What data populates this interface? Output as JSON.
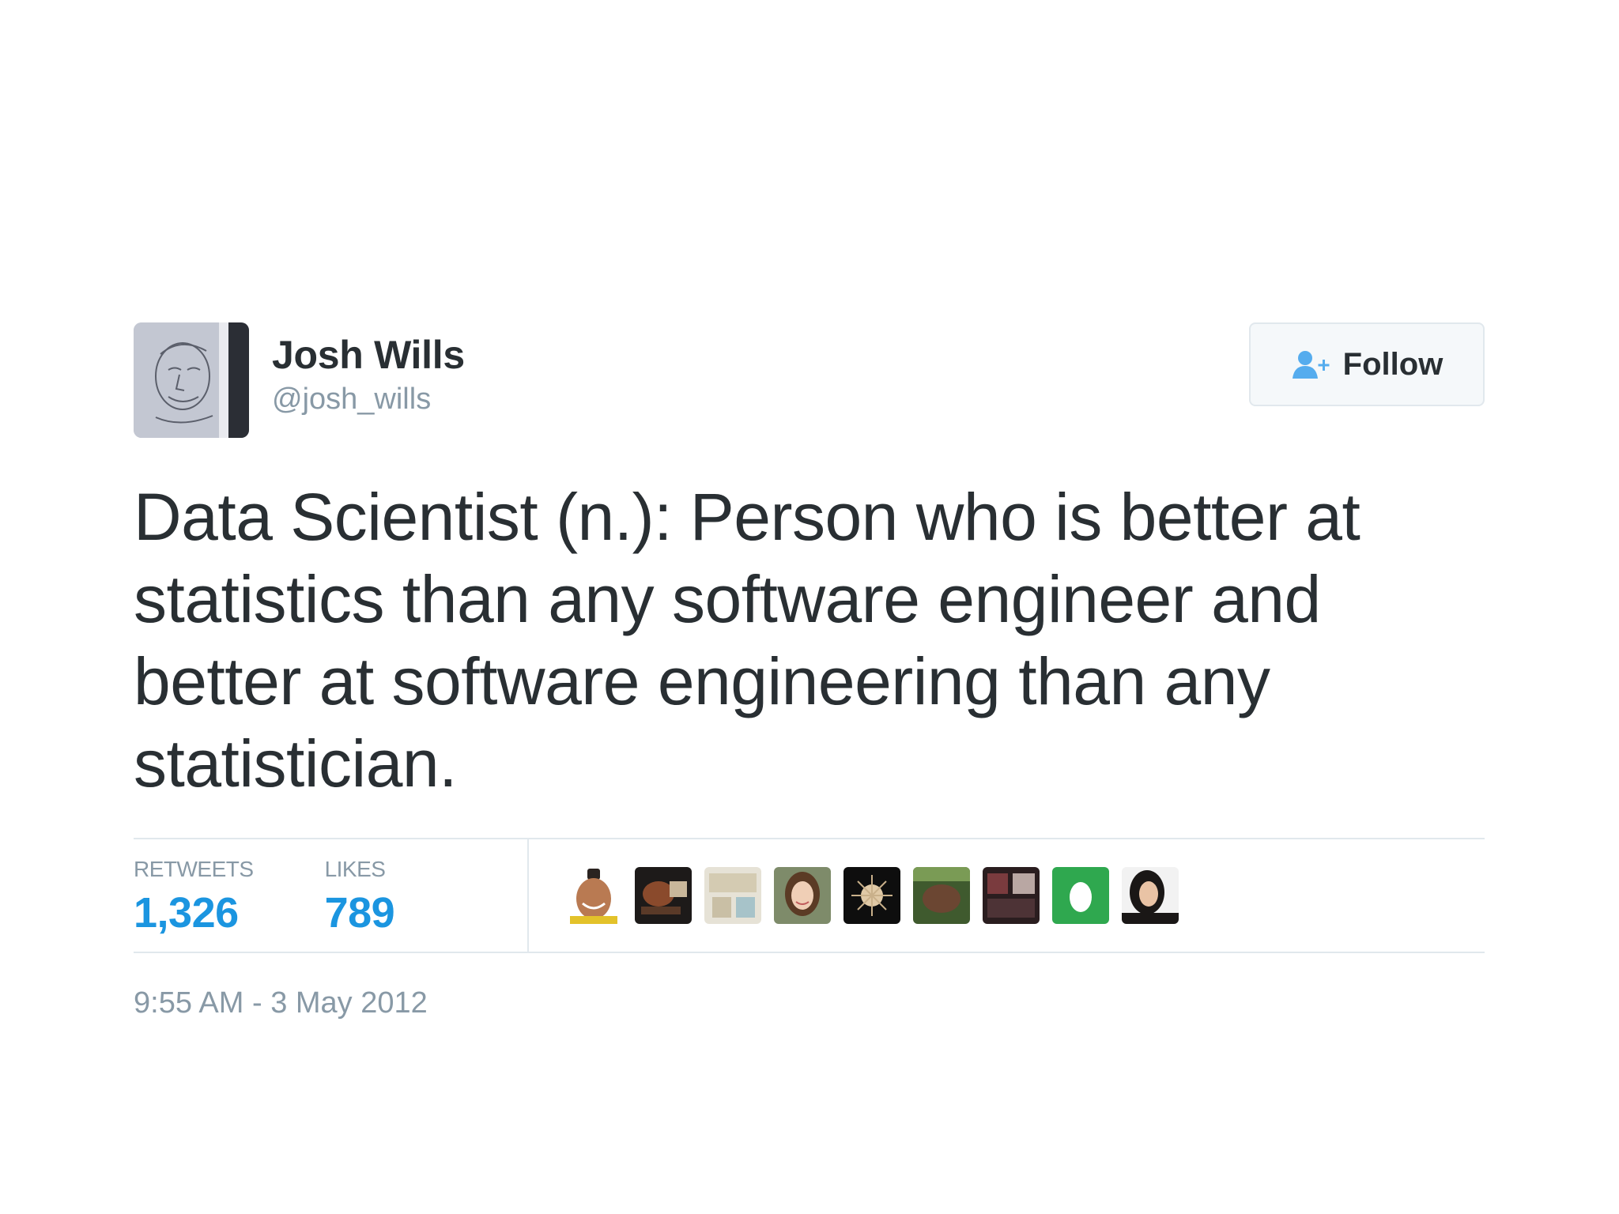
{
  "tweet": {
    "author": {
      "display_name": "Josh Wills",
      "handle": "@josh_wills",
      "avatar_icon": "caricature-sketch-avatar"
    },
    "follow_button": {
      "label": "Follow",
      "icon": "add-user-icon"
    },
    "text": "Data Scientist (n.): Person who is better at statistics than any software engineer and better at software engineering than any statistician.",
    "stats": {
      "retweets_label": "RETWEETS",
      "retweets_value": "1,326",
      "likes_label": "LIKES",
      "likes_value": "789"
    },
    "timestamp": "9:55 AM - 3 May 2012"
  },
  "colors": {
    "text": "#292f33",
    "muted": "#8899a6",
    "accent": "#1b95e0",
    "border": "#e1e8ed",
    "follow_icon": "#55acee"
  }
}
